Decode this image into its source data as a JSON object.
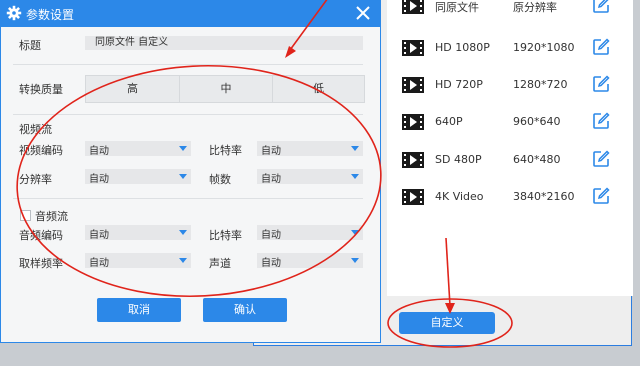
{
  "dialog": {
    "title": "参数设置",
    "title_label": "标题",
    "title_value": "同原文件 自定义",
    "quality_label": "转换质量",
    "quality_options": [
      "高",
      "中",
      "低"
    ],
    "video_stream_label": "视频流",
    "video_codec_label": "视频编码",
    "video_codec_value": "自动",
    "video_bitrate_label": "比特率",
    "video_bitrate_value": "自动",
    "resolution_label": "分辨率",
    "resolution_value": "自动",
    "framerate_label": "帧数",
    "framerate_value": "自动",
    "audio_stream_label": "音频流",
    "audio_codec_label": "音频编码",
    "audio_codec_value": "自动",
    "audio_bitrate_label": "比特率",
    "audio_bitrate_value": "自动",
    "sample_rate_label": "取样频率",
    "sample_rate_value": "自动",
    "channel_label": "声道",
    "channel_value": "自动",
    "cancel_label": "取消",
    "confirm_label": "确认"
  },
  "presets": [
    {
      "name": "同原文件",
      "resolution": "原分辨率",
      "icon": "video-file-icon"
    },
    {
      "name": "HD 1080P",
      "resolution": "1920*1080",
      "icon": "video-file-icon"
    },
    {
      "name": "HD 720P",
      "resolution": "1280*720",
      "icon": "video-file-icon"
    },
    {
      "name": "640P",
      "resolution": "960*640",
      "icon": "video-file-icon"
    },
    {
      "name": "SD 480P",
      "resolution": "640*480",
      "icon": "video-file-icon"
    },
    {
      "name": "4K Video",
      "resolution": "3840*2160",
      "icon": "video-file-icon"
    }
  ],
  "custom_button_label": "自定义",
  "colors": {
    "accent": "#2c88e8",
    "annotation": "#e0241b"
  }
}
